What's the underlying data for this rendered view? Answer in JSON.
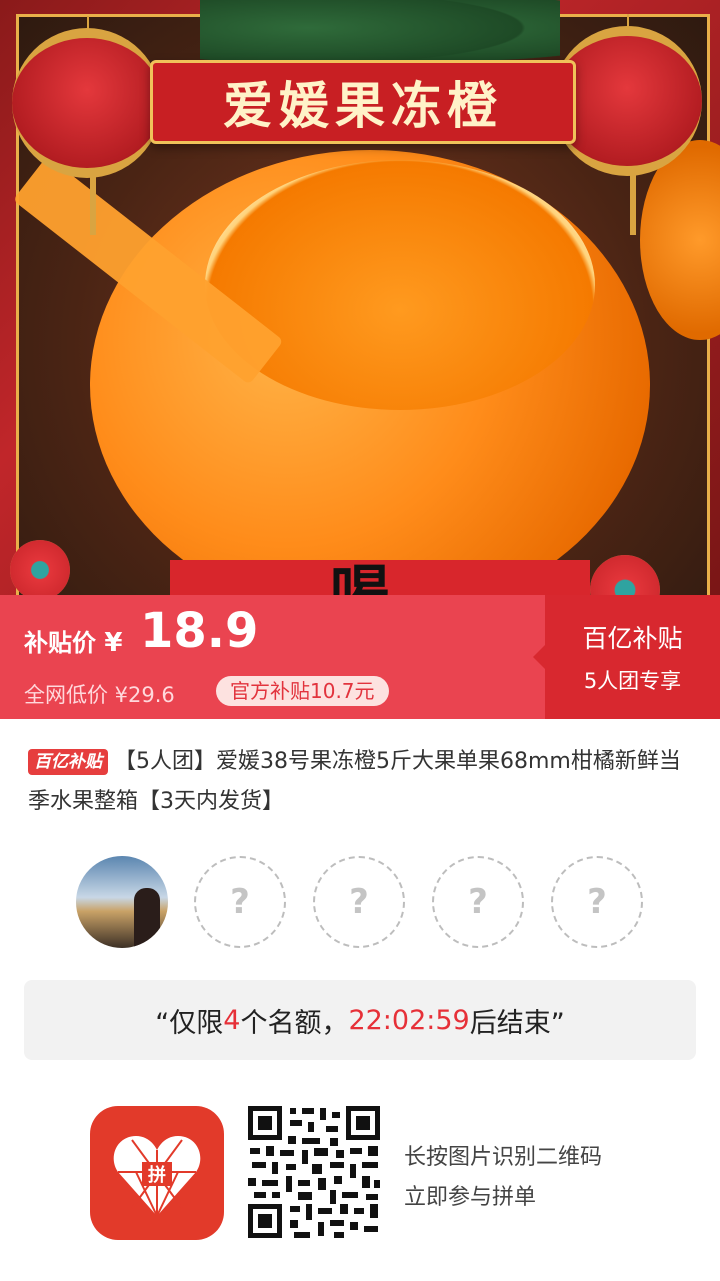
{
  "hero": {
    "title": "爱媛果冻橙",
    "overlay_text": "喝"
  },
  "price": {
    "label": "补贴价",
    "currency": "¥",
    "value": "18.9",
    "original": "全网低价 ¥29.6",
    "subsidy_chip": "官方补贴10.7元"
  },
  "promo": {
    "title": "百亿补贴",
    "subtitle": "5人团专享"
  },
  "product": {
    "badge": "百亿补贴",
    "title": "【5人团】爱媛38号果冻橙5斤大果单果68mm柑橘新鲜当季水果整箱【3天内发货】"
  },
  "group": {
    "slots": [
      {
        "type": "photo",
        "icon": "user-avatar"
      },
      {
        "type": "empty",
        "placeholder": "?"
      },
      {
        "type": "empty",
        "placeholder": "?"
      },
      {
        "type": "empty",
        "placeholder": "?"
      },
      {
        "type": "empty",
        "placeholder": "?"
      }
    ]
  },
  "notice": {
    "prefix": "“仅限",
    "count": "4",
    "middle": "个名额，",
    "time": "22:02:59",
    "suffix": "后结束”"
  },
  "footer": {
    "line1": "长按图片识别二维码",
    "line2": "立即参与拼单",
    "logo_glyph": "拼"
  },
  "colors": {
    "accent": "#ea4450",
    "promo_bg": "#d8282f",
    "countdown": "#e63038"
  }
}
